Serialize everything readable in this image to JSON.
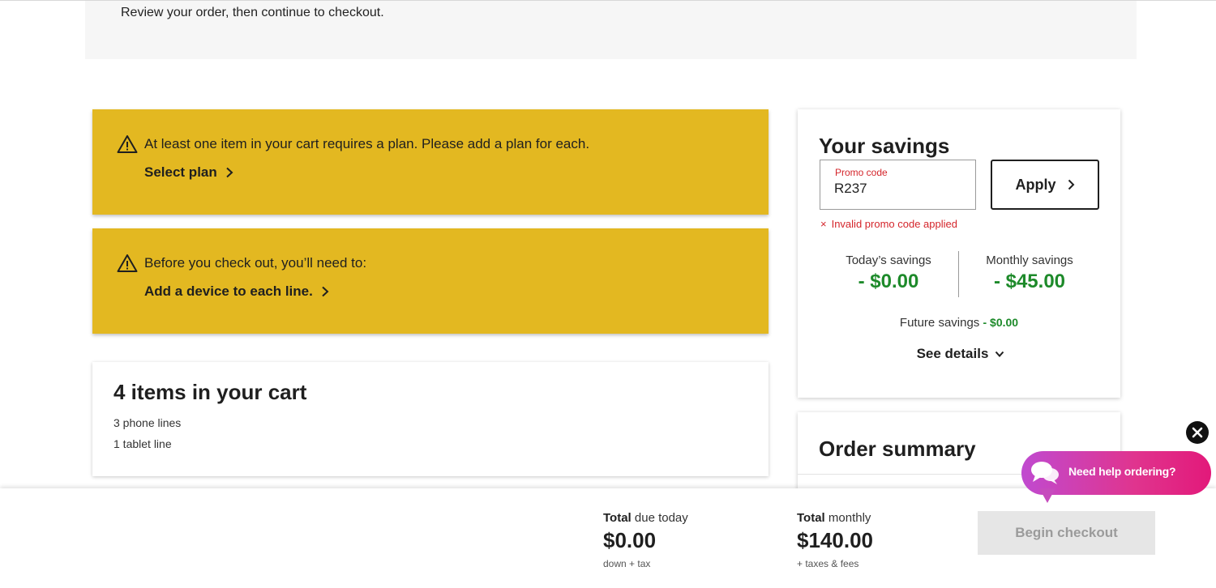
{
  "header": {
    "review_text": "Review your order, then continue to checkout."
  },
  "alerts": [
    {
      "message": "At least one item in your cart requires a plan. Please add a plan for each.",
      "link": "Select plan"
    },
    {
      "message": "Before you check out, you’ll need to:",
      "link": "Add a device to each line."
    }
  ],
  "cart": {
    "title": "4 items in your cart",
    "lines": [
      "3 phone lines",
      "1 tablet line"
    ]
  },
  "savings": {
    "title": "Your savings",
    "promo": {
      "label": "Promo code",
      "value": "R237",
      "error": "Invalid promo code applied",
      "error_icon": "×"
    },
    "apply_label": "Apply",
    "today_label": "Today’s savings",
    "today_value": "- $0.00",
    "monthly_label": "Monthly savings",
    "monthly_value": "- $45.00",
    "future_label": "Future savings",
    "future_value": "- $0.00",
    "details_label": "See details"
  },
  "order_summary": {
    "title": "Order summary"
  },
  "footer": {
    "today": {
      "bold": "Total",
      "rest": "due today",
      "amount": "$0.00",
      "sub": "down + tax"
    },
    "monthly": {
      "bold": "Total",
      "rest": "monthly",
      "amount": "$140.00",
      "sub": "+ taxes & fees"
    },
    "checkout_label": "Begin checkout"
  },
  "chat": {
    "label": "Need help ordering?"
  },
  "colors": {
    "alert_yellow": "#e3b821",
    "savings_green": "#1d8a2a",
    "error_red": "#d4252b",
    "chat_pink": "#e2197a",
    "chat_purple": "#c04ad0"
  },
  "icons": {
    "alert": "warning-triangle-icon",
    "chevron": "chevron-right-icon",
    "details": "chevron-down-icon",
    "chat": "chat-bubbles-icon",
    "close": "close-icon"
  }
}
